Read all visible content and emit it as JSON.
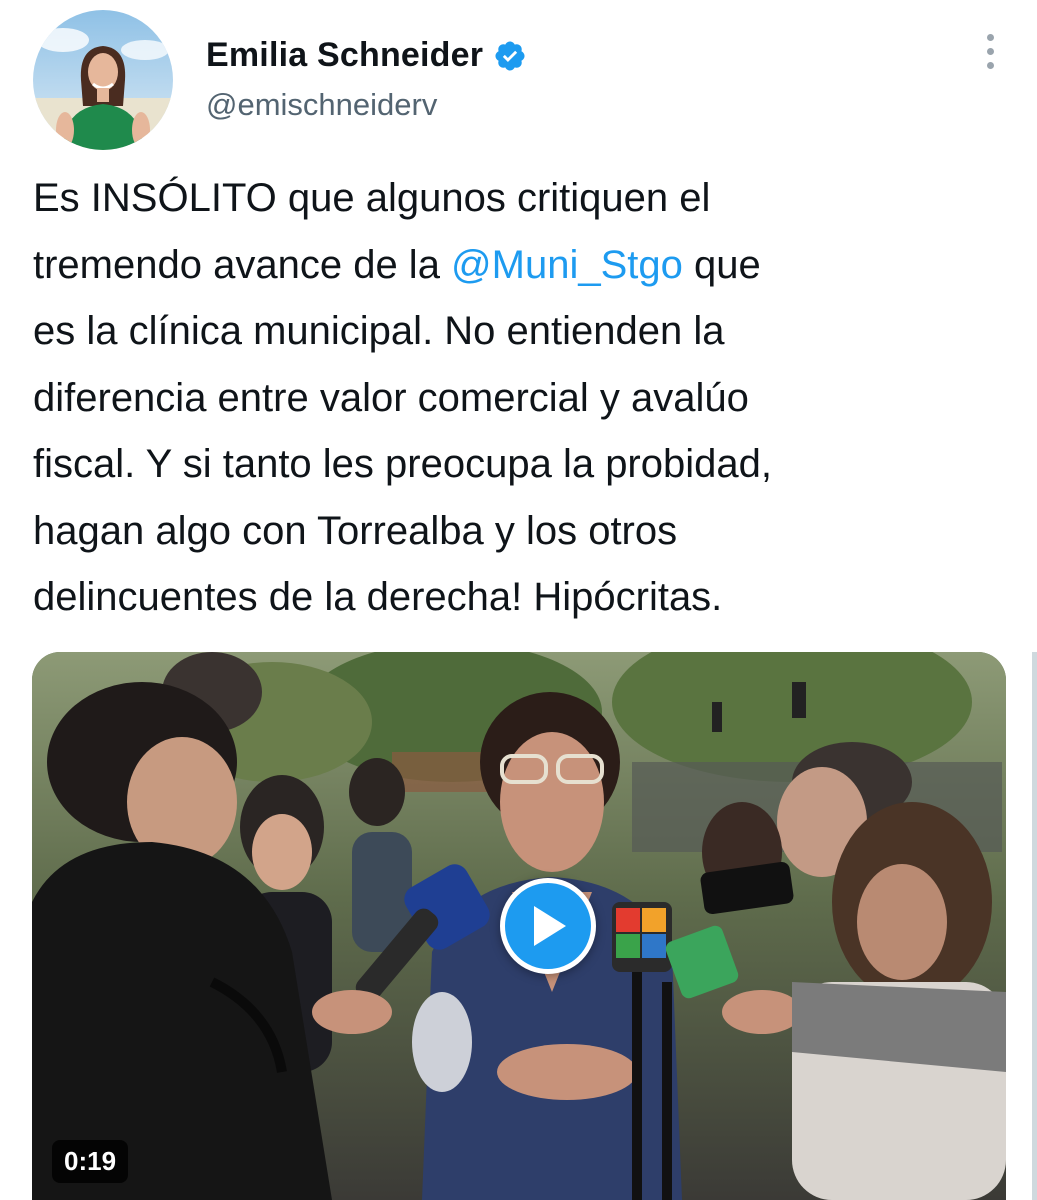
{
  "user": {
    "display_name": "Emilia Schneider",
    "handle": "@emischneiderv",
    "verified": true,
    "avatar_icon": "profile-photo",
    "verified_color": "#1d9bf0"
  },
  "tweet": {
    "lines": [
      "Es INSÓLITO que algunos critiquen el",
      "tremendo avance de la ",
      "es la clínica municipal. No entienden la",
      "diferencia entre valor comercial y avalúo",
      "fiscal. Y si tanto les preocupa la probidad,",
      "hagan algo con Torrealba y los otros",
      "delincuentes de la derecha! Hipócritas."
    ],
    "mention": "@Muni_Stgo",
    "after_mention": " que",
    "mention_color": "#1d9bf0"
  },
  "media": {
    "duration": "0:19",
    "play_icon": "play-icon",
    "accent": "#1d9bf0"
  },
  "menu_icon": "more-vertical-icon"
}
